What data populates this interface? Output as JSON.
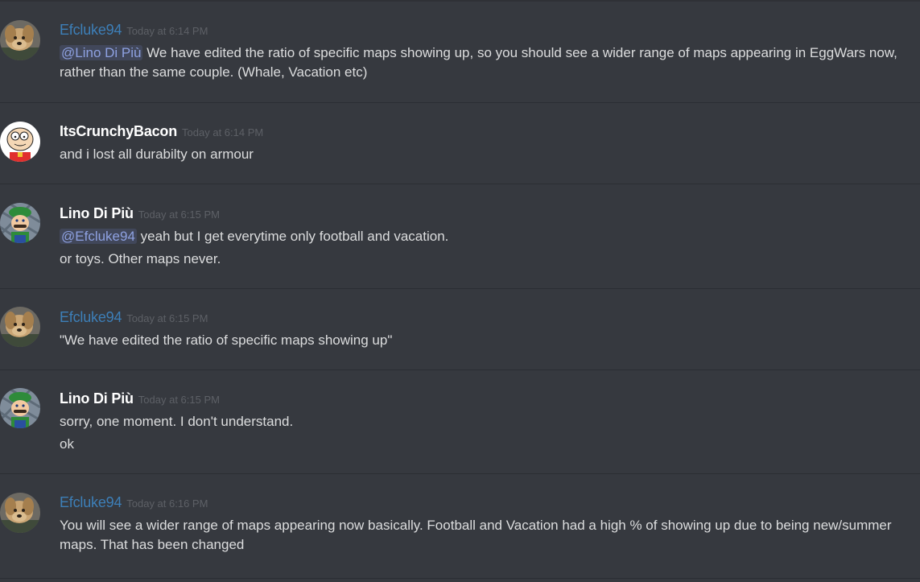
{
  "messages": [
    {
      "author": "Efcluke94",
      "timestamp": "Today at 6:14 PM",
      "mention": "@Lino Di Più",
      "line1": " We have edited the ratio of specific maps showing up, so you should see a wider range of maps appearing in EggWars now,",
      "line2": "rather than the same couple.  (Whale, Vacation etc)"
    },
    {
      "author": "ItsCrunchyBacon",
      "timestamp": "Today at 6:14 PM",
      "line1": "and i lost all durabilty on armour"
    },
    {
      "author": "Lino Di Più",
      "timestamp": "Today at 6:15 PM",
      "mention": "@Efcluke94",
      "line1": " yeah but I get everytime only football and vacation.",
      "line2": "or toys. Other maps never."
    },
    {
      "author": "Efcluke94",
      "timestamp": "Today at 6:15 PM",
      "line1": "\"We have edited the ratio of specific maps showing up\""
    },
    {
      "author": "Lino Di Più",
      "timestamp": "Today at 6:15 PM",
      "line1": "sorry, one moment. I don't understand.",
      "line2": "ok"
    },
    {
      "author": "Efcluke94",
      "timestamp": "Today at 6:16 PM",
      "line1": "You will see a wider range of maps appearing now basically. Football and Vacation had a high % of showing up due to being new/summer",
      "line2": "maps. That has been changed"
    }
  ],
  "colors": {
    "background": "#36393f",
    "staff_name": "#3d7fb8",
    "user_name": "#ffffff",
    "timestamp": "#5d6066",
    "mention": "#8ea1e1"
  },
  "avatars": {
    "Efcluke94": "dog-avatar-icon",
    "ItsCrunchyBacon": "cartoon-face-avatar-icon",
    "Lino Di Più": "luigi-avatar-icon"
  }
}
